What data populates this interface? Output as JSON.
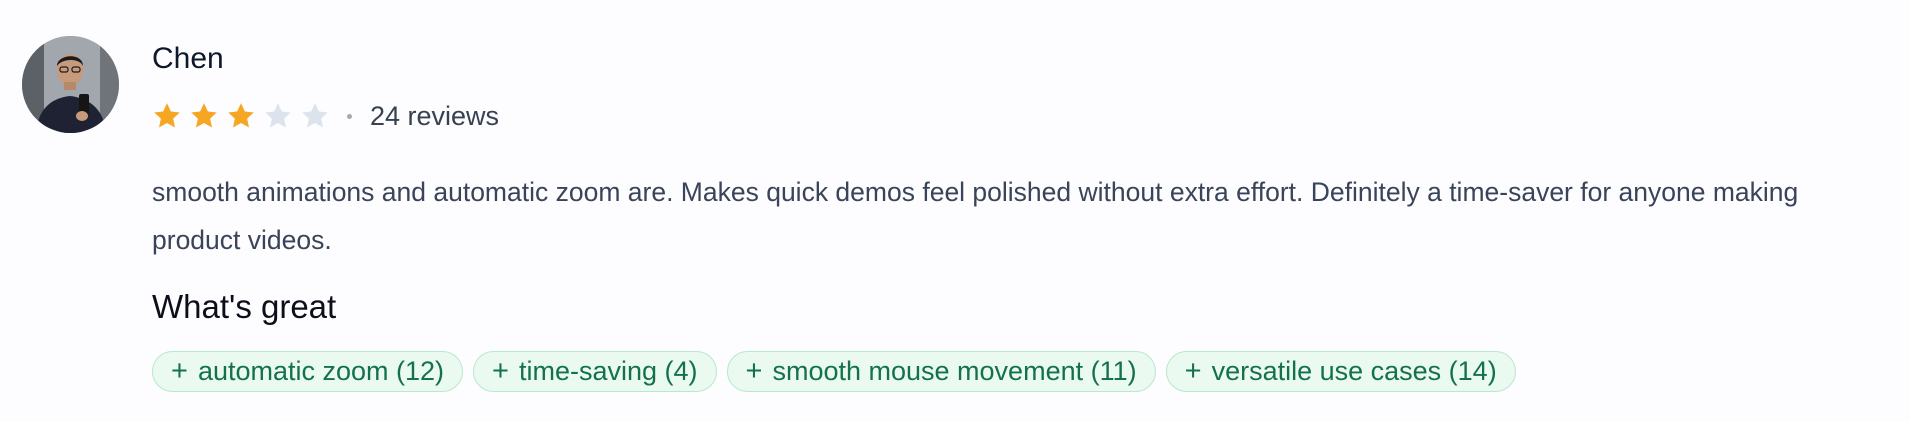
{
  "review": {
    "author": "Chen",
    "rating": 3,
    "max_rating": 5,
    "separator": "·",
    "review_count_text": "24 reviews",
    "body": "smooth animations and automatic zoom are. Makes quick demos feel polished without extra effort. Definitely a time-saver for anyone making product videos.",
    "whats_great_title": "What's great",
    "tags": [
      {
        "plus": "+",
        "label": "automatic zoom (12)"
      },
      {
        "plus": "+",
        "label": "time-saving (4)"
      },
      {
        "plus": "+",
        "label": "smooth mouse movement (11)"
      },
      {
        "plus": "+",
        "label": "versatile use cases (14)"
      }
    ]
  },
  "colors": {
    "star_filled": "#f5a623",
    "star_empty": "#dde3ec",
    "tag_text": "#14724b",
    "tag_bg": "#eafaf1",
    "tag_border": "#b7e9cc"
  },
  "icons": {
    "avatar": "user-photo",
    "star": "star-icon"
  }
}
